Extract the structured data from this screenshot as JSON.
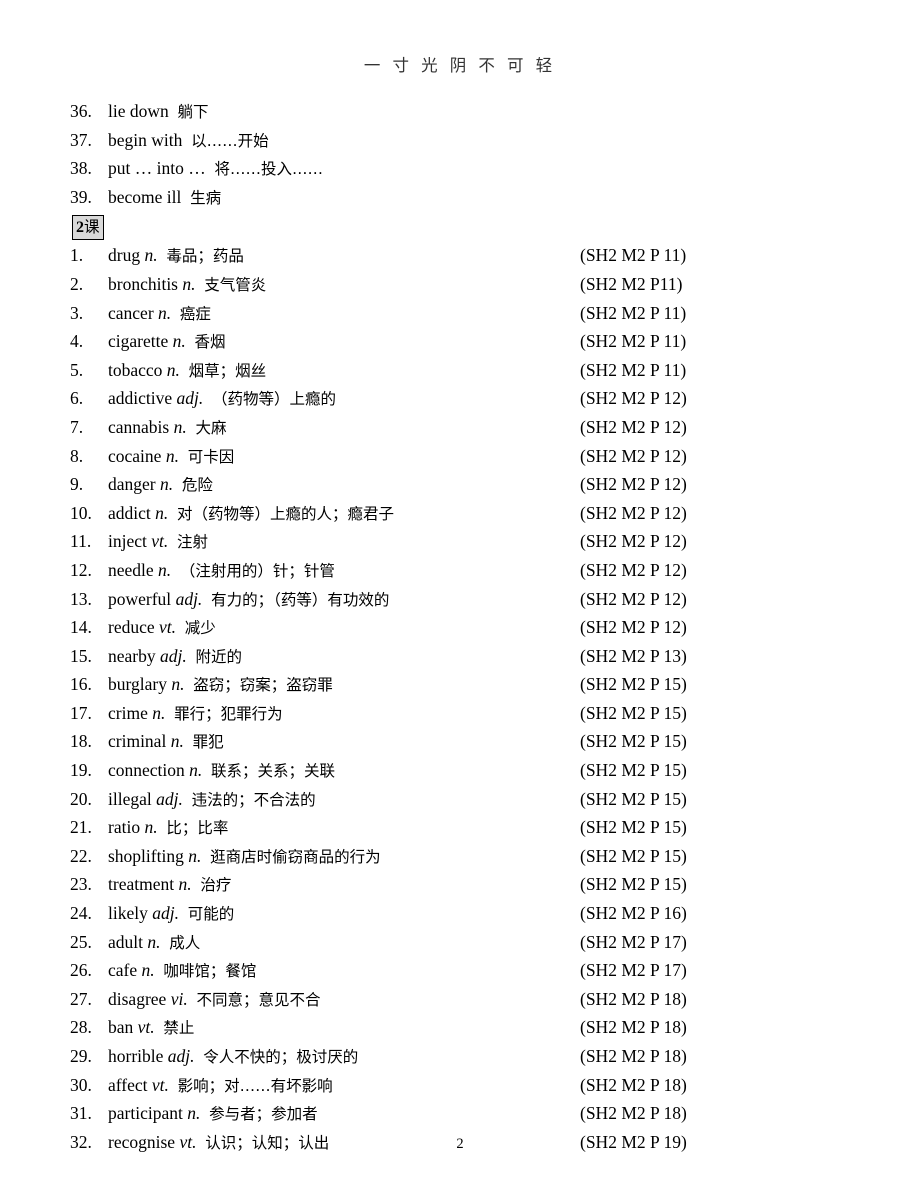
{
  "header": {
    "title": "一 寸 光 阴 不 可 轻"
  },
  "footer": {
    "page_number": "2"
  },
  "lesson_label": {
    "number": "2",
    "text": "课"
  },
  "prev_section_items": [
    {
      "num": "36.",
      "word": "lie down",
      "pos": "",
      "cn": "躺下"
    },
    {
      "num": "37.",
      "word": "begin with",
      "pos": "",
      "cn": "以……开始"
    },
    {
      "num": "38.",
      "word": "put … into …",
      "pos": "",
      "cn": "将……投入……"
    },
    {
      "num": "39.",
      "word": "become ill",
      "pos": "",
      "cn": "生病"
    }
  ],
  "lesson_items": [
    {
      "num": "1.",
      "word": "drug",
      "pos": "n.",
      "cn": "毒品；药品",
      "ref": "(SH2 M2 P 11)"
    },
    {
      "num": "2.",
      "word": "bronchitis",
      "pos": "n.",
      "cn": "支气管炎",
      "ref": "(SH2 M2 P11)"
    },
    {
      "num": "3.",
      "word": "cancer",
      "pos": "n.",
      "cn": "癌症",
      "ref": "(SH2 M2 P 11)"
    },
    {
      "num": "4.",
      "word": "cigarette",
      "pos": "n.",
      "cn": "香烟",
      "ref": "(SH2 M2 P 11)"
    },
    {
      "num": "5.",
      "word": "tobacco",
      "pos": "n.",
      "cn": "烟草；烟丝",
      "ref": "(SH2 M2 P 11)"
    },
    {
      "num": "6.",
      "word": "addictive",
      "pos": "adj.",
      "cn": "（药物等）上瘾的",
      "ref": "(SH2 M2 P 12)"
    },
    {
      "num": "7.",
      "word": "cannabis",
      "pos": "n.",
      "cn": "大麻",
      "ref": "(SH2 M2 P 12)"
    },
    {
      "num": "8.",
      "word": "cocaine",
      "pos": "n.",
      "cn": "可卡因",
      "ref": "(SH2 M2 P 12)"
    },
    {
      "num": "9.",
      "word": "danger",
      "pos": "n.",
      "cn": "危险",
      "ref": "(SH2 M2 P 12)"
    },
    {
      "num": "10.",
      "word": "addict",
      "pos": "n.",
      "cn": "对（药物等）上瘾的人；瘾君子",
      "ref": "(SH2 M2 P 12)"
    },
    {
      "num": "11.",
      "word": "inject",
      "pos": "vt.",
      "cn": "注射",
      "ref": "(SH2 M2 P 12)"
    },
    {
      "num": "12.",
      "word": "needle",
      "pos": "n.",
      "cn": "（注射用的）针；针管",
      "ref": "(SH2 M2 P 12)"
    },
    {
      "num": "13.",
      "word": "powerful",
      "pos": "adj.",
      "cn": "有力的；（药等）有功效的",
      "ref": "(SH2 M2 P 12)"
    },
    {
      "num": "14.",
      "word": "reduce",
      "pos": "vt.",
      "cn": "减少",
      "ref": "(SH2 M2 P 12)"
    },
    {
      "num": "15.",
      "word": "nearby",
      "pos": "adj.",
      "cn": "附近的",
      "ref": "(SH2 M2 P 13)"
    },
    {
      "num": "16.",
      "word": "burglary",
      "pos": "n.",
      "cn": "盗窃；窃案；盗窃罪",
      "ref": "(SH2 M2 P 15)"
    },
    {
      "num": "17.",
      "word": "crime",
      "pos": "n.",
      "cn": "罪行；犯罪行为",
      "ref": "(SH2 M2 P 15)"
    },
    {
      "num": "18.",
      "word": "criminal",
      "pos": "n.",
      "cn": "罪犯",
      "ref": "(SH2 M2 P 15)"
    },
    {
      "num": "19.",
      "word": "connection",
      "pos": "n.",
      "cn": "联系；关系；关联",
      "ref": "(SH2 M2 P 15)"
    },
    {
      "num": "20.",
      "word": "illegal",
      "pos": "adj.",
      "cn": "违法的；不合法的",
      "ref": "(SH2 M2 P 15)"
    },
    {
      "num": "21.",
      "word": "ratio",
      "pos": "n.",
      "cn": "比；比率",
      "ref": "(SH2 M2 P 15)"
    },
    {
      "num": "22.",
      "word": "shoplifting",
      "pos": "n.",
      "cn": "逛商店时偷窃商品的行为",
      "ref": "(SH2 M2 P 15)"
    },
    {
      "num": "23.",
      "word": "treatment",
      "pos": "n.",
      "cn": "治疗",
      "ref": "(SH2 M2 P 15)"
    },
    {
      "num": "24.",
      "word": "likely",
      "pos": "adj.",
      "cn": "可能的",
      "ref": "(SH2 M2 P 16)"
    },
    {
      "num": "25.",
      "word": "adult",
      "pos": "n.",
      "cn": "成人",
      "ref": "(SH2 M2 P 17)"
    },
    {
      "num": "26.",
      "word": "cafe",
      "pos": "n.",
      "cn": "咖啡馆；餐馆",
      "ref": "(SH2 M2 P 17)"
    },
    {
      "num": "27.",
      "word": "disagree",
      "pos": "vi.",
      "cn": "不同意；意见不合",
      "ref": "(SH2 M2 P 18)"
    },
    {
      "num": "28.",
      "word": "ban",
      "pos": "vt.",
      "cn": "禁止",
      "ref": "(SH2 M2 P 18)"
    },
    {
      "num": "29.",
      "word": "horrible",
      "pos": "adj.",
      "cn": "令人不快的；极讨厌的",
      "ref": "(SH2 M2 P 18)"
    },
    {
      "num": "30.",
      "word": "affect",
      "pos": "vt.",
      "cn": "影响；对……有坏影响",
      "ref": "(SH2 M2 P 18)"
    },
    {
      "num": "31.",
      "word": "participant",
      "pos": "n.",
      "cn": "参与者；参加者",
      "ref": "(SH2 M2 P 18)"
    },
    {
      "num": "32.",
      "word": "recognise",
      "pos": "vt.",
      "cn": "认识；认知；认出",
      "ref": "(SH2 M2 P 19)"
    }
  ]
}
